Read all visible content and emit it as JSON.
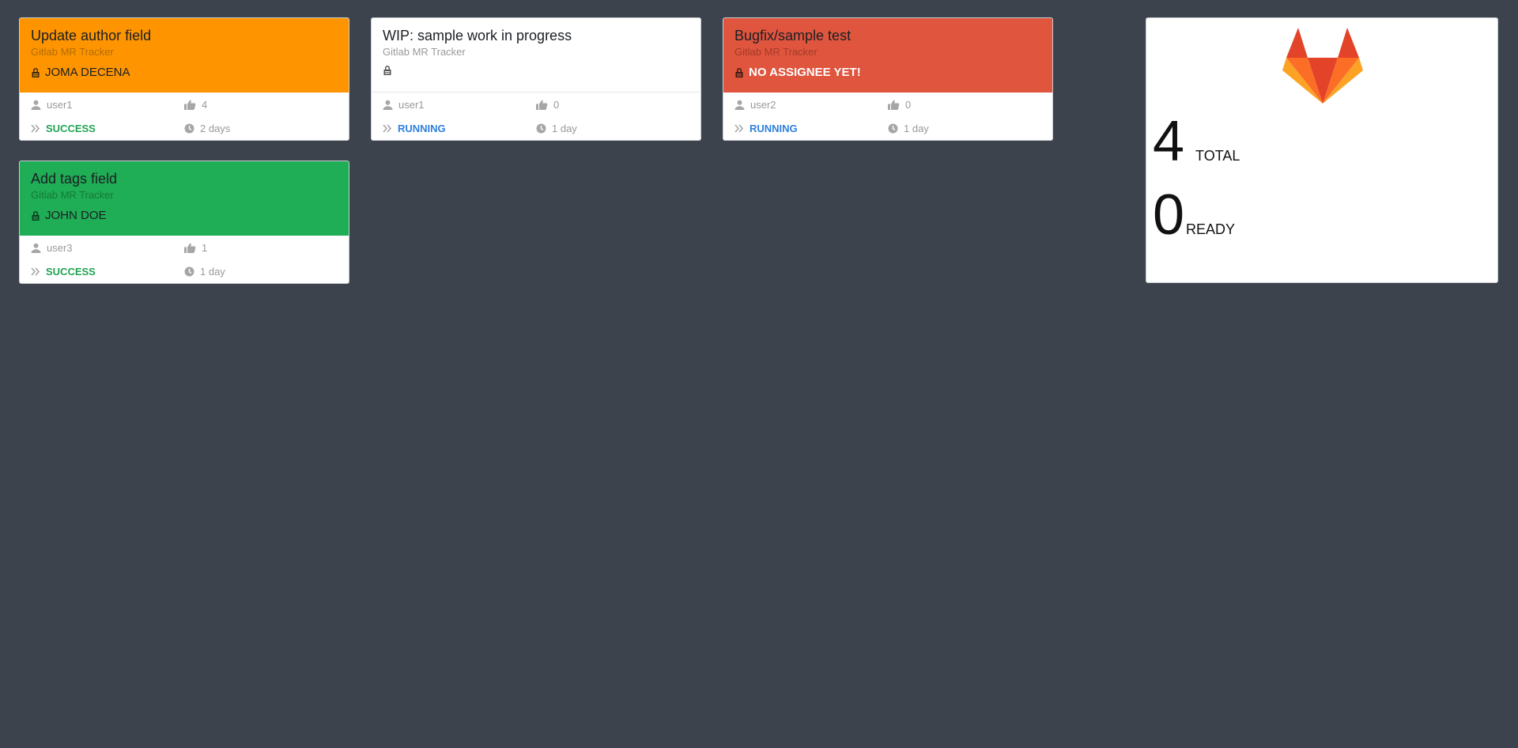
{
  "colors": {
    "background": "#3c434d",
    "orange": "#fe9500",
    "white": "#ffffff",
    "red": "#e0553e",
    "green": "#1fad55",
    "success_text": "#22a356",
    "running_text": "#2f7fdd",
    "meta_text": "#999999"
  },
  "cards": [
    {
      "title": "Update author field",
      "project": "Gitlab MR Tracker",
      "assignee": "JOMA DECENA",
      "author": "user1",
      "upvotes": "4",
      "status": "SUCCESS",
      "age": "2 days"
    },
    {
      "title": "WIP: sample work in progress",
      "project": "Gitlab MR Tracker",
      "assignee": "",
      "author": "user1",
      "upvotes": "0",
      "status": "RUNNING",
      "age": "1 day"
    },
    {
      "title": "Bugfix/sample test",
      "project": "Gitlab MR Tracker",
      "assignee": "NO ASSIGNEE YET!",
      "author": "user2",
      "upvotes": "0",
      "status": "RUNNING",
      "age": "1 day"
    },
    {
      "title": "Add tags field",
      "project": "Gitlab MR Tracker",
      "assignee": "JOHN DOE",
      "author": "user3",
      "upvotes": "1",
      "status": "SUCCESS",
      "age": "1 day"
    }
  ],
  "stats": {
    "logo_icon": "gitlab-logo-icon",
    "total_value": "4",
    "total_label": "TOTAL",
    "ready_value": "0",
    "ready_label": "READY"
  }
}
